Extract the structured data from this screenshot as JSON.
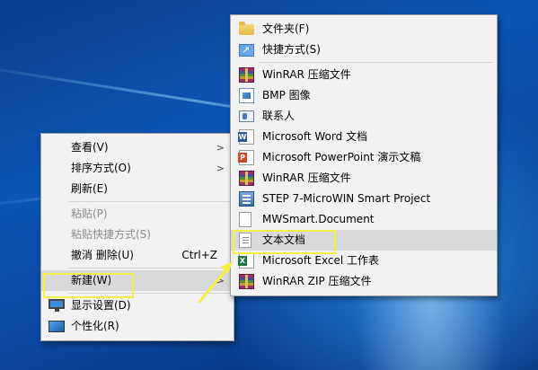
{
  "context_menu": {
    "items": [
      {
        "label": "查看(V)",
        "submenu": true
      },
      {
        "label": "排序方式(O)",
        "submenu": true
      },
      {
        "label": "刷新(E)"
      },
      {
        "label": "粘贴(P)",
        "disabled": true
      },
      {
        "label": "粘贴快捷方式(S)",
        "disabled": true
      },
      {
        "label": "撤消 删除(U)",
        "shortcut": "Ctrl+Z"
      },
      {
        "label": "新建(W)",
        "submenu": true,
        "highlighted": true
      },
      {
        "label": "显示设置(D)",
        "icon": "display-settings-icon"
      },
      {
        "label": "个性化(R)",
        "icon": "personalize-icon"
      }
    ],
    "submenu_arrow": ">"
  },
  "new_submenu": {
    "items": [
      {
        "label": "文件夹(F)",
        "icon": "folder-icon"
      },
      {
        "label": "快捷方式(S)",
        "icon": "shortcut-icon"
      },
      {
        "label": "WinRAR 压缩文件",
        "icon": "winrar-icon"
      },
      {
        "label": "BMP 图像",
        "icon": "bmp-image-icon"
      },
      {
        "label": "联系人",
        "icon": "contact-icon"
      },
      {
        "label": "Microsoft Word 文档",
        "icon": "word-document-icon"
      },
      {
        "label": "Microsoft PowerPoint 演示文稿",
        "icon": "powerpoint-icon"
      },
      {
        "label": "WinRAR 压缩文件",
        "icon": "winrar-icon"
      },
      {
        "label": "STEP 7-MicroWIN Smart Project",
        "icon": "step7-project-icon"
      },
      {
        "label": "MWSmart.Document",
        "icon": "document-icon"
      },
      {
        "label": "文本文档",
        "icon": "text-document-icon",
        "highlighted": true
      },
      {
        "label": "Microsoft Excel 工作表",
        "icon": "excel-icon"
      },
      {
        "label": "WinRAR ZIP 压缩文件",
        "icon": "winrar-zip-icon"
      }
    ]
  },
  "colors": {
    "annotation": "#f5ef47",
    "menu_background": "#f2f2f2",
    "hover_background": "#d9d9d9",
    "desktop_blue": "#0c56b5"
  }
}
